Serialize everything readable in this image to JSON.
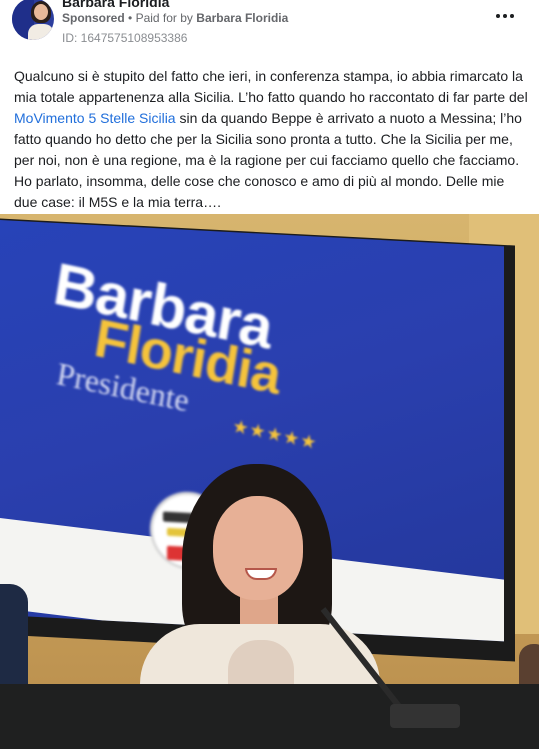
{
  "header": {
    "page_name": "Barbara Floridia",
    "sponsored_label": "Sponsored",
    "separator": "•",
    "paid_for_prefix": "Paid for by",
    "paid_for_name": "Barbara Floridia",
    "ad_id": "ID: 1647575108953386",
    "more_icon": "more-horizontal-icon"
  },
  "post": {
    "text_before_link": "Qualcuno si è stupito del fatto che ieri, in conferenza stampa, io abbia rimarcato la mia totale appartenenza alla Sicilia. L’ho fatto quando ho raccontato di far parte del ",
    "link_text": "MoVimento 5 Stelle Sicilia",
    "text_after_link": " sin da quando Beppe è arrivato a nuoto a Messina; l’ho fatto quando ho detto che per la Sicilia sono pronta a tutto. Che la Sicilia per me, per noi, non è una regione, ma è la ragione per cui facciamo quello che facciamo. Ho parlato, insomma, delle cose che conosco e amo di più al mondo. Delle mie due case: il M5S e la mia terra…."
  },
  "media": {
    "banner_line1": "Barbara",
    "banner_line2": "Floridia",
    "banner_line3": "Presidente",
    "banner_stars": "★★★★★"
  },
  "colors": {
    "link": "#216fdb",
    "banner_blue": "#2a3fae",
    "banner_yellow": "#f5c33b"
  }
}
